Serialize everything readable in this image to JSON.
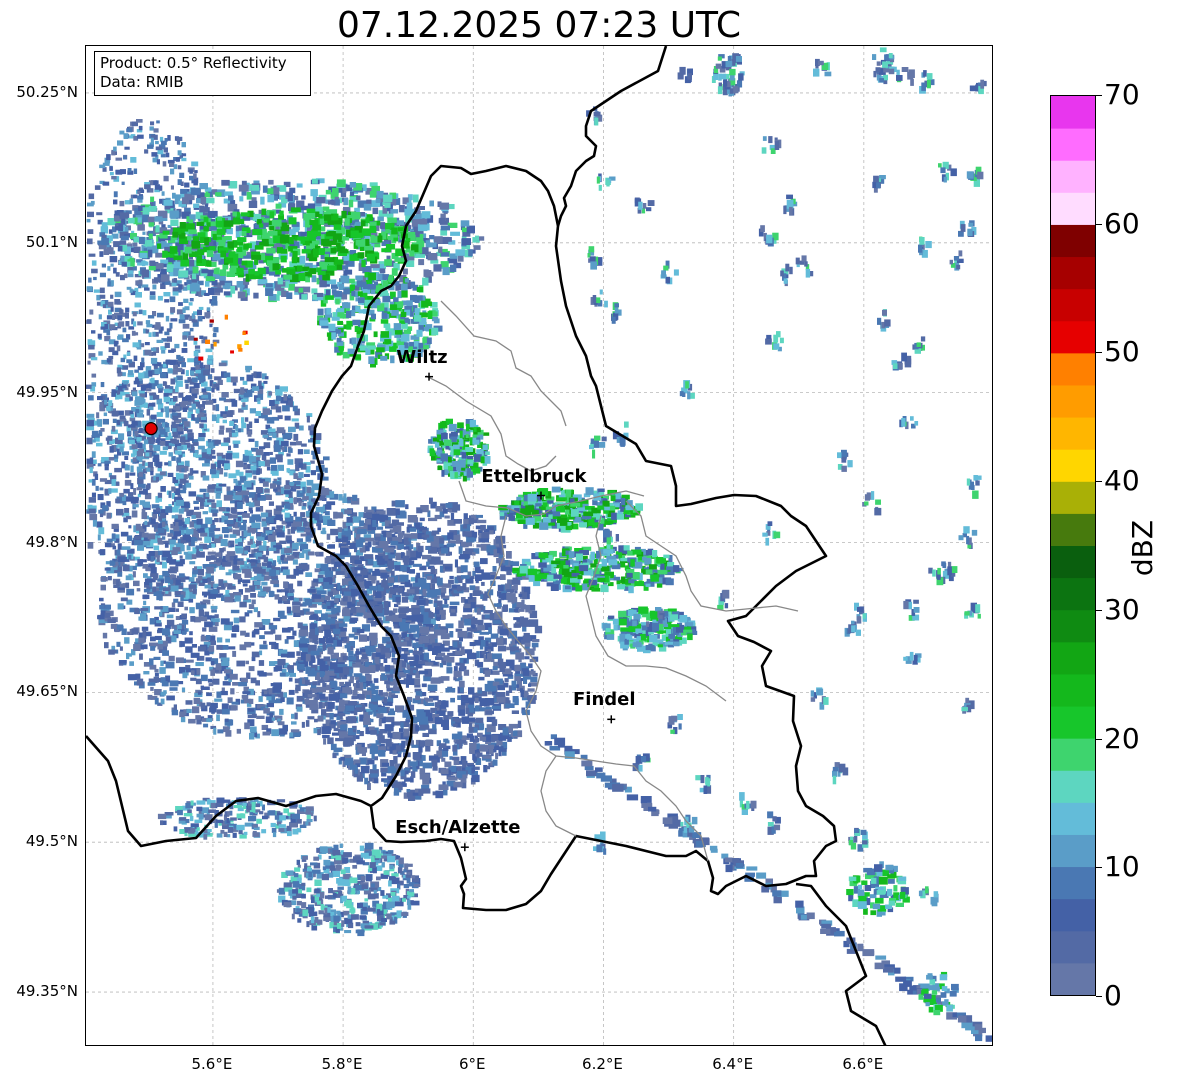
{
  "title": "07.12.2025 07:23 UTC",
  "info_box": {
    "product_line": "Product: 0.5° Reflectivity",
    "data_line": "Data: RMIB"
  },
  "axes": {
    "lon_min": 5.405,
    "lon_max": 6.8,
    "lat_min": 49.295,
    "lat_max": 50.297,
    "x_ticks": [
      {
        "value": 5.6,
        "label": "5.6°E"
      },
      {
        "value": 5.8,
        "label": "5.8°E"
      },
      {
        "value": 6.0,
        "label": "6°E"
      },
      {
        "value": 6.2,
        "label": "6.2°E"
      },
      {
        "value": 6.4,
        "label": "6.4°E"
      },
      {
        "value": 6.6,
        "label": "6.6°E"
      }
    ],
    "y_ticks": [
      {
        "value": 50.25,
        "label": "50.25°N"
      },
      {
        "value": 50.1,
        "label": "50.1°N"
      },
      {
        "value": 49.95,
        "label": "49.95°N"
      },
      {
        "value": 49.8,
        "label": "49.8°N"
      },
      {
        "value": 49.65,
        "label": "49.65°N"
      },
      {
        "value": 49.5,
        "label": "49.5°N"
      },
      {
        "value": 49.35,
        "label": "49.35°N"
      }
    ],
    "gridlines": true
  },
  "cities": [
    {
      "name": "Wiltz",
      "lon": 5.932,
      "lat": 49.966
    },
    {
      "name": "Ettelbruck",
      "lon": 6.104,
      "lat": 49.847
    },
    {
      "name": "Findel",
      "lon": 6.212,
      "lat": 49.623
    },
    {
      "name": "Esch/Alzette",
      "lon": 5.987,
      "lat": 49.495
    }
  ],
  "radar_site": {
    "lon": 5.505,
    "lat": 49.914,
    "color": "#e00000"
  },
  "colorbar": {
    "label": "dBZ",
    "min": 0,
    "max": 70,
    "ticks": [
      {
        "value": 0,
        "label": "0"
      },
      {
        "value": 10,
        "label": "10"
      },
      {
        "value": 20,
        "label": "20"
      },
      {
        "value": 30,
        "label": "30"
      },
      {
        "value": 40,
        "label": "40"
      },
      {
        "value": 50,
        "label": "50"
      },
      {
        "value": 60,
        "label": "60"
      },
      {
        "value": 70,
        "label": "70"
      }
    ],
    "colors": [
      "#6577a8",
      "#536aa5",
      "#4461a6",
      "#4a78b3",
      "#5a9dc8",
      "#63bcd9",
      "#5dd6c0",
      "#3ed46e",
      "#17c62b",
      "#14b81c",
      "#12a614",
      "#0f8b12",
      "#0c7411",
      "#0a5f0e",
      "#477a0d",
      "#a9b006",
      "#ffd600",
      "#ffb600",
      "#ff9c00",
      "#ff8000",
      "#e60000",
      "#c80000",
      "#a60000",
      "#7f0000",
      "#ffdcff",
      "#ffb2ff",
      "#ff6cff",
      "#e836ee"
    ]
  }
}
